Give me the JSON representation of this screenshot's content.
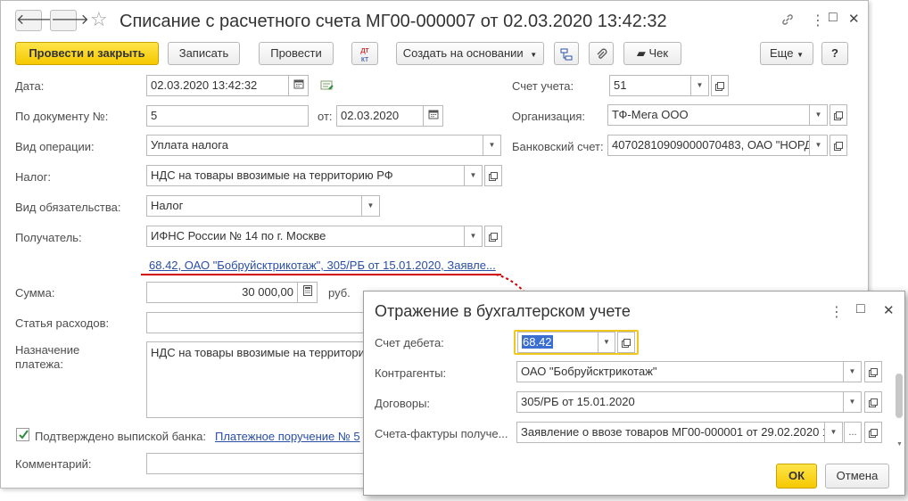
{
  "main_window": {
    "title": "Списание с расчетного счета МГ00-000007 от 02.03.2020 13:42:32",
    "nav": {
      "back": "🡐",
      "forward": "🡒",
      "star": "☆"
    },
    "header_icons": {
      "link": "🔗",
      "more": "⋮",
      "maximize": "□",
      "close": "✕"
    },
    "toolbar": {
      "post_close": "Провести и закрыть",
      "save": "Записать",
      "post": "Провести",
      "dtkt_top": "дт",
      "dtkt_bottom": "кт",
      "create_based": "Создать на основании",
      "receipt": "Чек",
      "more": "Еще",
      "help": "?"
    },
    "fields": {
      "date_label": "Дата:",
      "date_value": "02.03.2020 13:42:32",
      "doc_number_label": "По документу №:",
      "doc_number_value": "5",
      "from_label": "от:",
      "from_value": "02.03.2020",
      "operation_label": "Вид операции:",
      "operation_value": "Уплата налога",
      "tax_label": "Налог:",
      "tax_value": "НДС на товары ввозимые на территорию РФ",
      "liability_label": "Вид обязательства:",
      "liability_value": "Налог",
      "recipient_label": "Получатель:",
      "recipient_value": "ИФНС России № 14 по г. Москве",
      "accounting_link": "68.42, ОАО \"Бобруйсктрикотаж\", 305/РБ от 15.01.2020, Заявле...",
      "amount_label": "Сумма:",
      "amount_value": "30 000,00",
      "currency": "руб.",
      "expense_label": "Статья расходов:",
      "expense_value": "",
      "purpose_label": "Назначение платежа:",
      "purpose_value": "НДС на товары ввозимые на территори",
      "confirmed_label": "Подтверждено выпиской банка:",
      "payment_order_link": "Платежное поручение № 5",
      "comment_label": "Комментарий:",
      "comment_value": "",
      "account_label": "Счет учета:",
      "account_value": "51",
      "organization_label": "Организация:",
      "organization_value": "ТФ-Мега ООО",
      "bank_account_label": "Банковский счет:",
      "bank_account_value": "40702810909000070483, ОАО \"НОРД"
    }
  },
  "dialog": {
    "title": "Отражение в бухгалтерском учете",
    "header_icons": {
      "more": "⋮",
      "maximize": "□",
      "close": "✕"
    },
    "debit_label": "Счет дебета:",
    "debit_value": "68.42",
    "counterparty_label": "Контрагенты:",
    "counterparty_value": "ОАО \"Бобруйсктрикотаж\"",
    "contract_label": "Договоры:",
    "contract_value": "305/РБ от 15.01.2020",
    "invoice_label": "Счета-фактуры получе...",
    "invoice_value": "Заявление о ввозе товаров МГ00-000001 от 29.02.2020 1",
    "invoice_ellipsis": "...",
    "ok": "ОК",
    "cancel": "Отмена"
  },
  "colors": {
    "accent_yellow": "#f5c800",
    "link_blue": "#2a4ea6",
    "annotation_red": "#d00000",
    "checkbox_green": "#2e8b3e"
  }
}
